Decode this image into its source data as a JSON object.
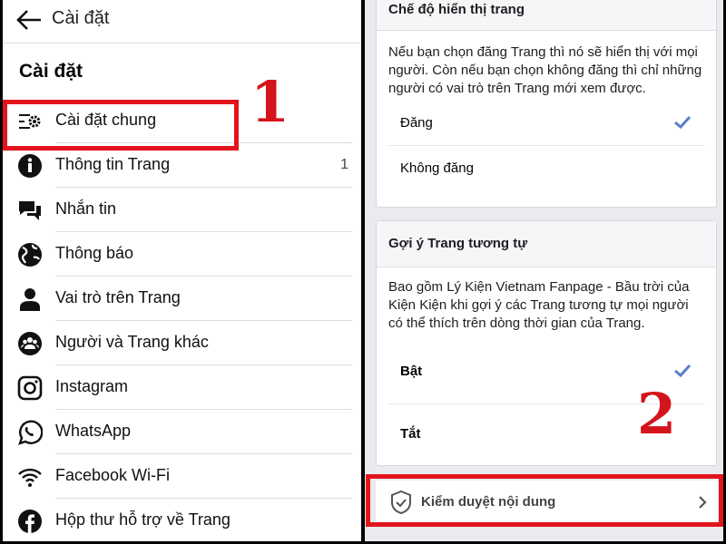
{
  "header": {
    "title": "Cài đặt"
  },
  "section_title": "Cài đặt",
  "menu": [
    {
      "label": "Cài đặt chung",
      "icon": "general-settings-icon"
    },
    {
      "label": "Thông tin Trang",
      "icon": "info-icon",
      "count": "1"
    },
    {
      "label": "Nhắn tin",
      "icon": "messages-icon"
    },
    {
      "label": "Thông báo",
      "icon": "globe-icon"
    },
    {
      "label": "Vai trò trên Trang",
      "icon": "person-icon"
    },
    {
      "label": "Người và Trang khác",
      "icon": "people-icon"
    },
    {
      "label": "Instagram",
      "icon": "instagram-icon"
    },
    {
      "label": "WhatsApp",
      "icon": "whatsapp-icon"
    },
    {
      "label": "Facebook Wi-Fi",
      "icon": "wifi-icon"
    },
    {
      "label": "Hộp thư hỗ trợ về Trang",
      "icon": "facebook-icon"
    }
  ],
  "visibility": {
    "title": "Chế độ hiển thị trang",
    "description": "Nếu bạn chọn đăng Trang thì nó sẽ hiển thị với mọi người. Còn nếu bạn chọn không đăng thì chỉ những người có vai trò trên Trang mới xem được.",
    "options": [
      {
        "label": "Đăng",
        "selected": true
      },
      {
        "label": "Không đăng",
        "selected": false
      }
    ]
  },
  "similar": {
    "title": "Gợi ý Trang tương tự",
    "description": "Bao gồm Lý Kiện Vietnam Fanpage - Bầu trời của Kiện Kiện khi gợi ý các Trang tương tự mọi người có thể thích trên dòng thời gian của Trang.",
    "options": [
      {
        "label": "Bật",
        "selected": true
      },
      {
        "label": "Tắt",
        "selected": false
      }
    ]
  },
  "moderation": {
    "label": "Kiểm duyệt nội dung",
    "icon": "shield-check-icon"
  },
  "annotations": {
    "step1": "1",
    "step2": "2"
  },
  "colors": {
    "highlight": "#e3141b",
    "check": "#5b7fc7"
  }
}
